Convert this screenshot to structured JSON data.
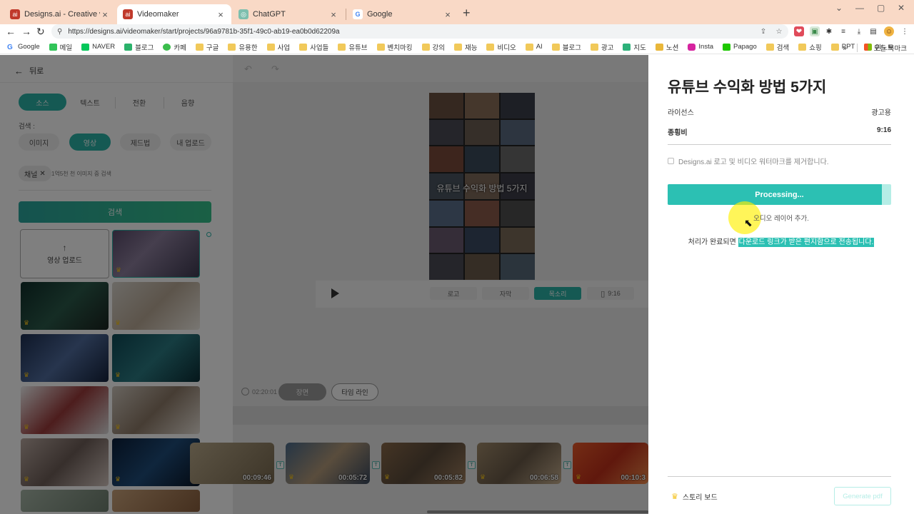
{
  "browser": {
    "tabs": [
      {
        "title": "Designs.ai - Creative work don",
        "favicon_color": "#c0392b"
      },
      {
        "title": "Videomaker",
        "favicon_color": "#c0392b"
      },
      {
        "title": "ChatGPT",
        "favicon_color": "#7dbfae"
      },
      {
        "title": "Google",
        "favicon_color": "#4285f4"
      }
    ],
    "url": "https://designs.ai/videomaker/start/projects/96a9781b-35f1-49c0-ab19-ea0b0d62209a",
    "bookmarks": [
      "Google",
      "메일",
      "NAVER",
      "블로그",
      "카페",
      "구글",
      "유용한",
      "사업",
      "사업들",
      "유튜브",
      "벤치마킹",
      "강의",
      "재능",
      "비디오",
      "AI",
      "블로그",
      "광고",
      "지도",
      "노션",
      "Insta",
      "Papago",
      "검색",
      "쇼핑",
      "PPT",
      "윈노트"
    ],
    "bookmarks_more": "»",
    "all_bookmarks": "모든 북마크"
  },
  "left": {
    "back": "뒤로",
    "tabs": [
      "소스",
      "텍스트",
      "전환",
      "음향"
    ],
    "search_label": "검색 :",
    "filters": [
      "이미지",
      "영상",
      "제드법",
      "내 업로드"
    ],
    "chip": "채널",
    "chip_hint": "1억5천 천 이미지 중 검색",
    "search_button": "검색",
    "upload": "영상 업로드"
  },
  "center": {
    "caption": "유튜브 수익화 방법 5가지",
    "controls": [
      "로고",
      "자막",
      "목소리",
      "9:16"
    ],
    "time": "02:20:01",
    "view_buttons": [
      "장면",
      "타임 라인"
    ],
    "clips": [
      "00:09:46",
      "00:05:72",
      "00:05:82",
      "00:06:58",
      "00:10:3"
    ],
    "clip_badge": "T"
  },
  "modal": {
    "title": "유튜브 수익화 방법 5가지",
    "license_label": "라이선스",
    "license_value": "광고용",
    "ratio_label": "종횡비",
    "ratio_value": "9:16",
    "watermark": "Designs.ai 로고 및 비디오 워터마크를 제거합니다.",
    "progress_label": "Processing...",
    "progress": 0.96,
    "sub": "오디오 레이어 추가.",
    "note_prefix": "처리가 완료되면 ",
    "note_highlight": "다운로드 링크가 받은 편지함으로 전송됩니다.",
    "storyboard": "스토리 보드",
    "pdf_button": "Generate pdf"
  },
  "colors": {
    "accent": "#2cc0b3",
    "tabstrip": "#f9d9c6"
  }
}
